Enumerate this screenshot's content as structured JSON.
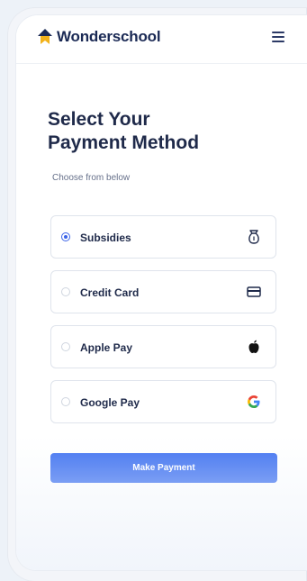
{
  "brand": {
    "name": "Wonderschool",
    "logo_icon": "wonderschool-house-icon",
    "accent": "#3a63e8"
  },
  "header": {
    "menu_icon": "hamburger-menu-icon"
  },
  "page": {
    "title_line1": "Select Your",
    "title_line2": "Payment Method",
    "subtitle": "Choose from below"
  },
  "payment_methods": [
    {
      "label": "Subsidies",
      "icon": "money-bag-icon",
      "selected": true
    },
    {
      "label": "Credit Card",
      "icon": "credit-card-icon",
      "selected": false
    },
    {
      "label": "Apple Pay",
      "icon": "apple-icon",
      "selected": false
    },
    {
      "label": "Google Pay",
      "icon": "google-icon",
      "selected": false
    }
  ],
  "actions": {
    "make_payment_label": "Make Payment",
    "button_color": "#3a6ef0"
  }
}
